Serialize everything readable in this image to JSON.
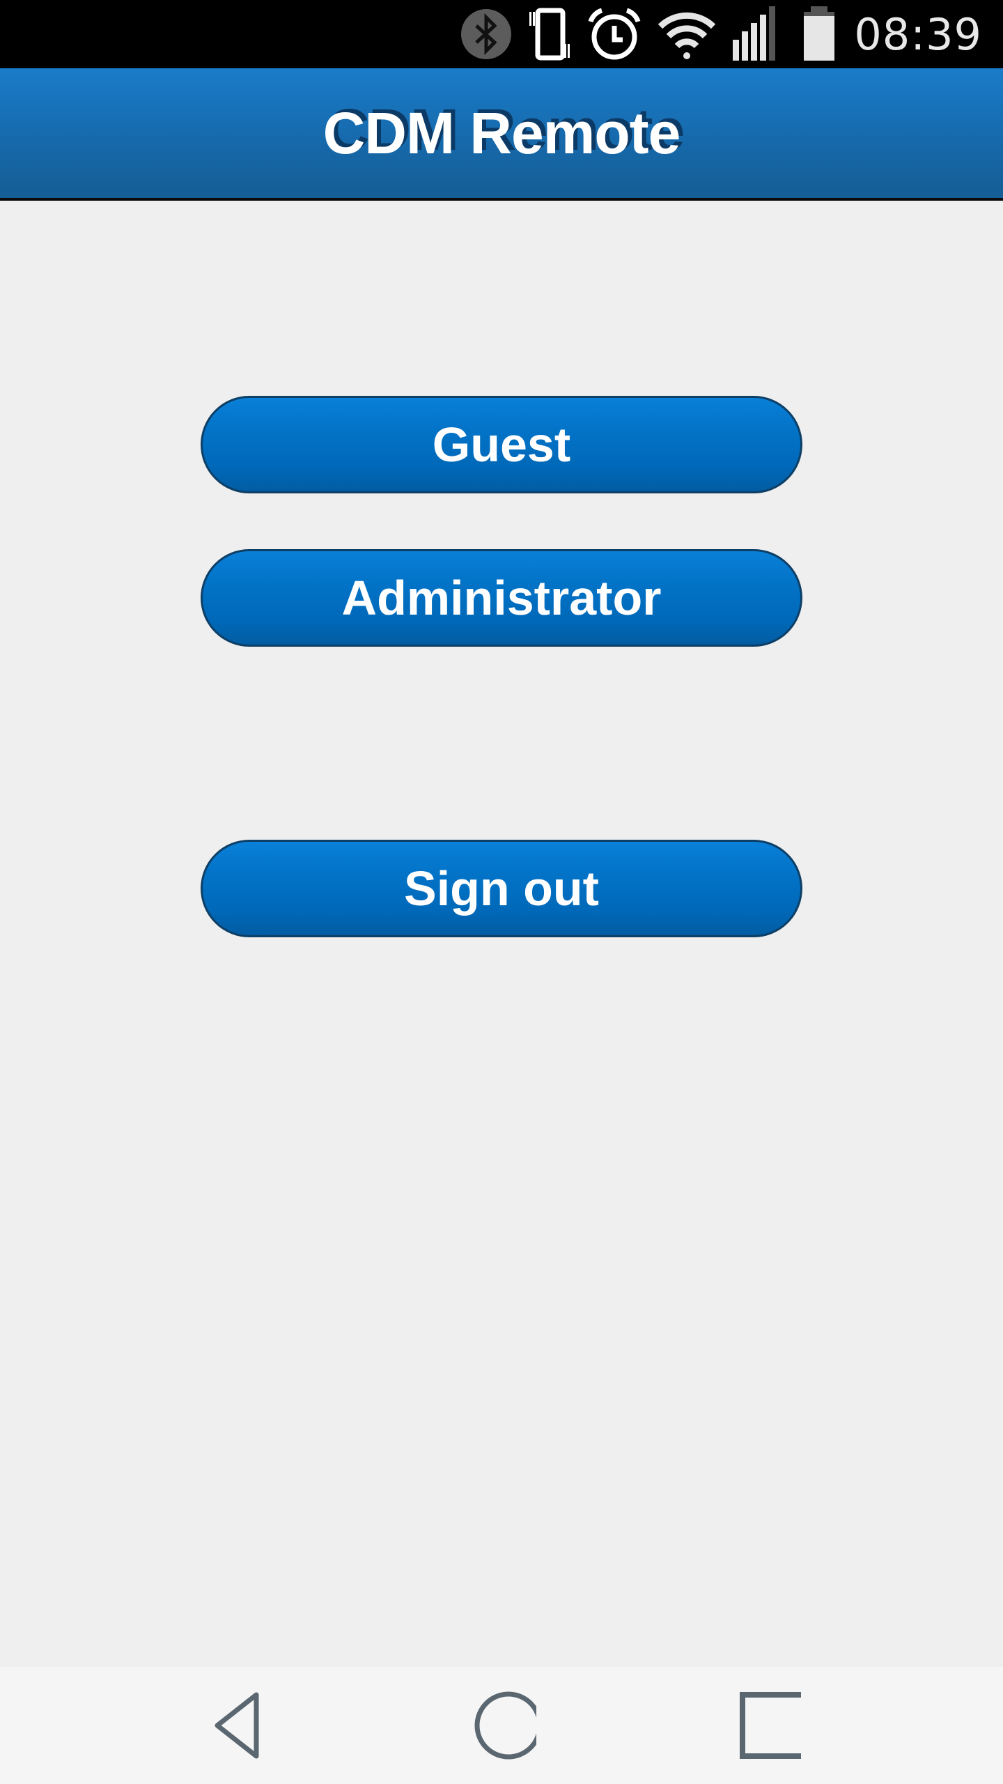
{
  "status_bar": {
    "time": "08:39",
    "icons": [
      "bluetooth-icon",
      "vibrate-icon",
      "alarm-icon",
      "wifi-icon",
      "cell-signal-icon",
      "battery-icon"
    ]
  },
  "header": {
    "title": "CDM Remote"
  },
  "main": {
    "buttons": [
      {
        "label": "Guest"
      },
      {
        "label": "Administrator"
      },
      {
        "label": "Sign out"
      }
    ]
  },
  "nav_bar": {
    "icons": [
      "back-icon",
      "home-icon",
      "recent-apps-icon"
    ]
  },
  "colors": {
    "header_top": "#1a7cc9",
    "header_bottom": "#155d95",
    "button_top": "#0a80d8",
    "button_bottom": "#025ca2",
    "button_border": "#0d3f66",
    "background": "#efefef",
    "nav_icon": "#5a6670"
  }
}
